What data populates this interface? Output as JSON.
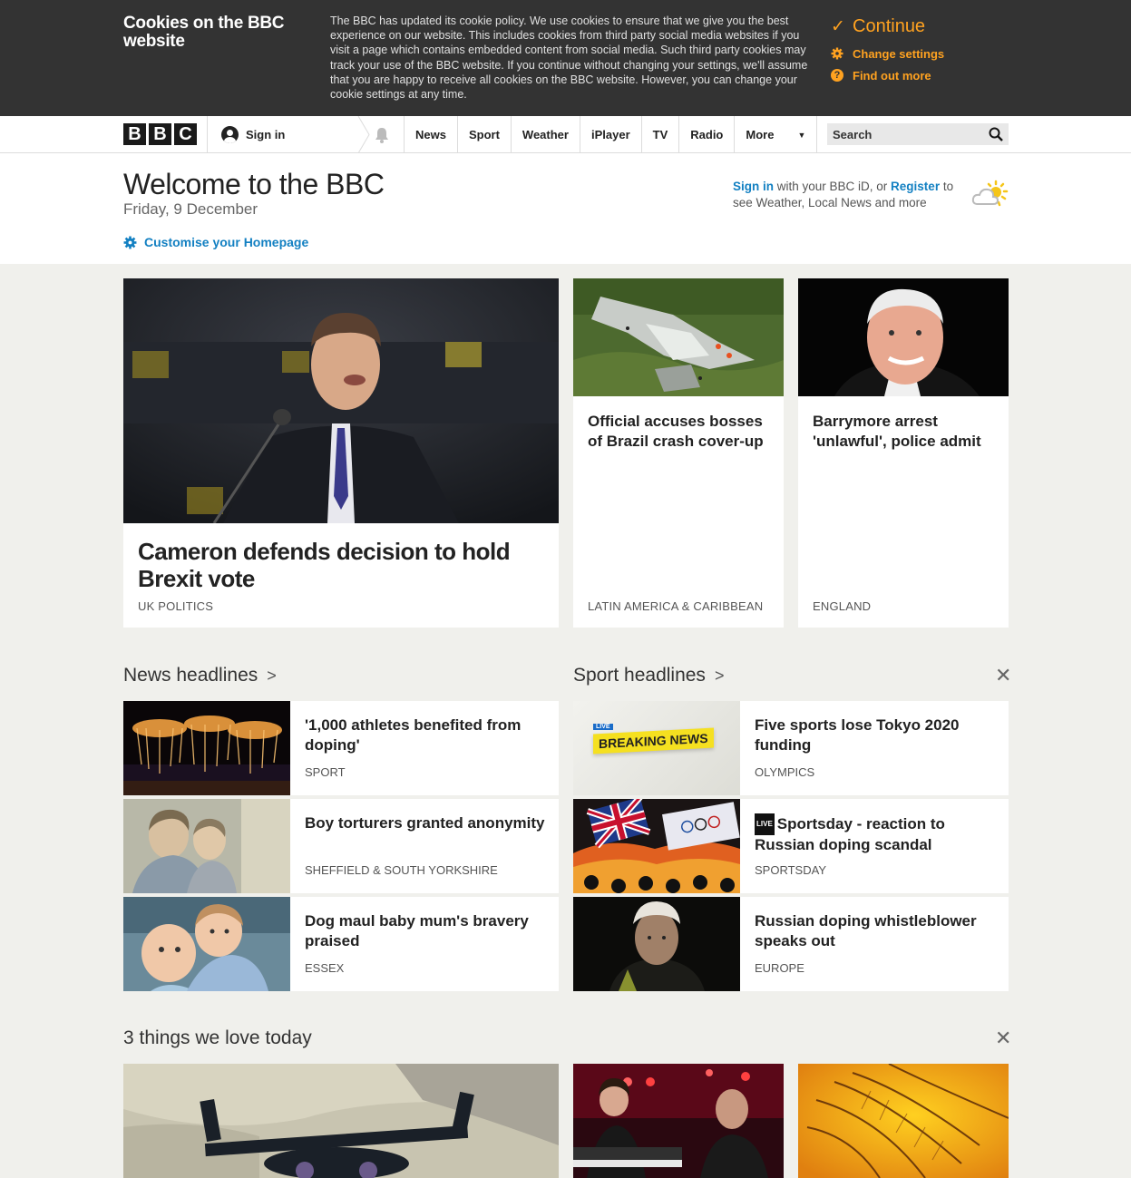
{
  "cookie": {
    "title": "Cookies on the BBC website",
    "text": "The BBC has updated its cookie policy. We use cookies to ensure that we give you the best experience on our website. This includes cookies from third party social media websites if you visit a page which contains embedded content from social media. Such third party cookies may track your use of the BBC website. If you continue without changing your settings, we'll assume that you are happy to receive all cookies on the BBC website. However, you can change your cookie settings at any time.",
    "continue_label": "Continue",
    "change_settings_label": "Change settings",
    "find_out_more_label": "Find out more",
    "accent_color": "#ffa220"
  },
  "nav": {
    "logo_letters": [
      "B",
      "B",
      "C"
    ],
    "sign_in_label": "Sign in",
    "items": [
      "News",
      "Sport",
      "Weather",
      "iPlayer",
      "TV",
      "Radio"
    ],
    "more_label": "More",
    "search_placeholder": "Search"
  },
  "welcome": {
    "title": "Welcome to the BBC",
    "date": "Friday, 9 December",
    "customise_label": "Customise your Homepage",
    "signin_link": "Sign in",
    "signin_text_1": " with your BBC iD, or ",
    "register_link": "Register",
    "signin_text_2": " to see Weather, Local News and more",
    "link_color": "#1380c2"
  },
  "top_stories": [
    {
      "title": "Cameron defends decision to hold Brexit vote",
      "tag": "UK POLITICS"
    },
    {
      "title": "Official accuses bosses of Brazil crash cover-up",
      "tag": "LATIN AMERICA & CARIBBEAN"
    },
    {
      "title": "Barrymore arrest 'unlawful', police admit",
      "tag": "ENGLAND"
    }
  ],
  "news_headlines": {
    "title": "News headlines",
    "items": [
      {
        "title": "'1,000 athletes benefited from doping'",
        "tag": "SPORT"
      },
      {
        "title": "Boy torturers granted anonymity",
        "tag": "SHEFFIELD & SOUTH YORKSHIRE"
      },
      {
        "title": "Dog maul baby mum's bravery praised",
        "tag": "ESSEX"
      }
    ]
  },
  "sport_headlines": {
    "title": "Sport headlines",
    "breaking_live": "LIVE",
    "breaking_text": "BREAKING NEWS",
    "items": [
      {
        "title": "Five sports lose Tokyo 2020 funding",
        "tag": "OLYMPICS"
      },
      {
        "live": "LIVE",
        "title": "Sportsday - reaction to Russian doping scandal",
        "tag": "SPORTSDAY"
      },
      {
        "title": "Russian doping whistleblower speaks out",
        "tag": "EUROPE"
      }
    ]
  },
  "three_things": {
    "title": "3 things we love today"
  },
  "section_chevron": ">",
  "close_glyph": "✕"
}
